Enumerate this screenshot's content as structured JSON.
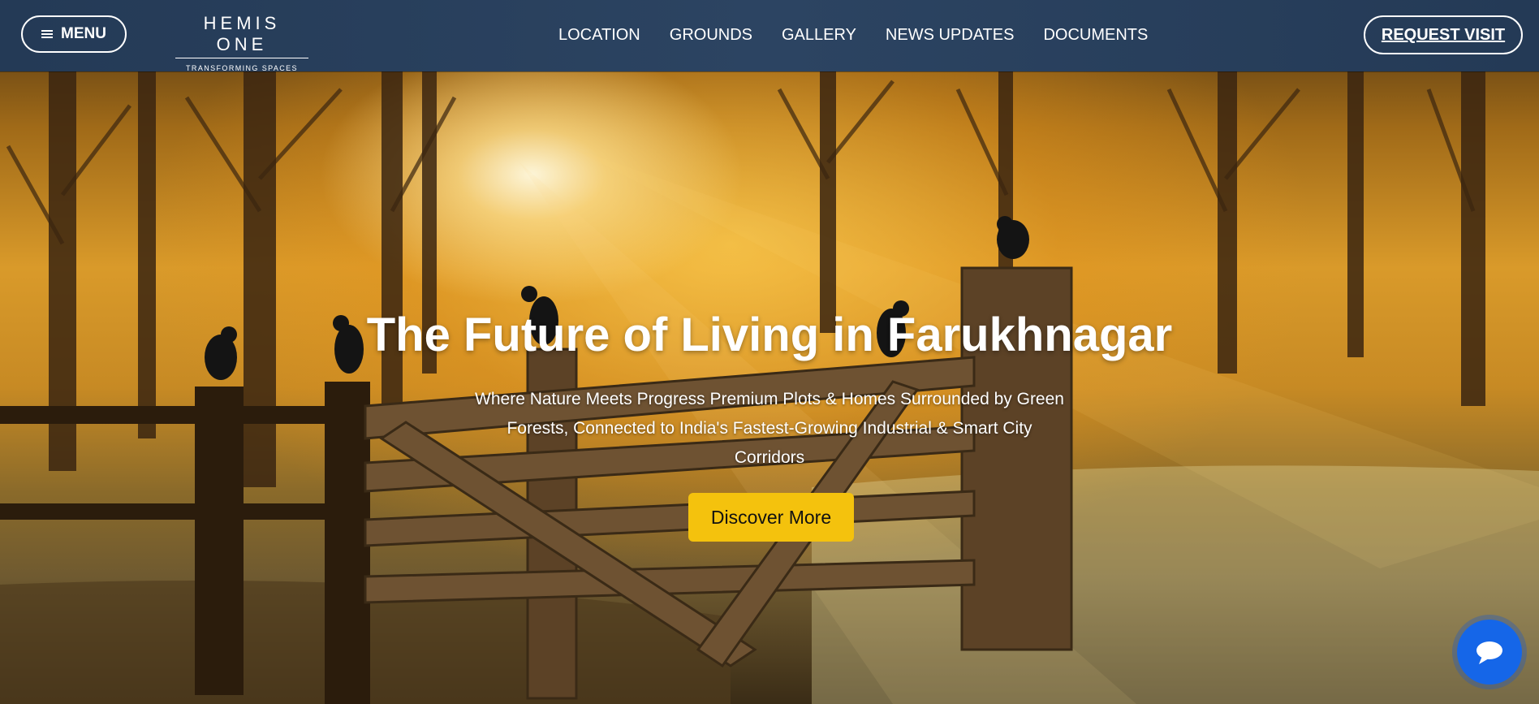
{
  "header": {
    "menu_label": "MENU",
    "logo": {
      "name": "HEMIS ONE",
      "tagline": "TRANSFORMING SPACES"
    },
    "nav": [
      "LOCATION",
      "GROUNDS",
      "GALLERY",
      "NEWS UPDATES",
      "DOCUMENTS"
    ],
    "request_visit_label": "REQUEST VISIT"
  },
  "hero": {
    "title": "The Future of Living in Farukhnagar",
    "subtitle": "Where Nature Meets Progress Premium Plots & Homes Surrounded by Green Forests, Connected to India's Fastest-Growing Industrial & Smart City Corridors",
    "cta_label": "Discover More"
  },
  "icons": {
    "menu": "hamburger-icon",
    "chat": "chat-bubble-icon"
  },
  "colors": {
    "header": "#2c4462",
    "cta": "#f4c20d",
    "chat": "#1566e8",
    "text": "#ffffff"
  }
}
